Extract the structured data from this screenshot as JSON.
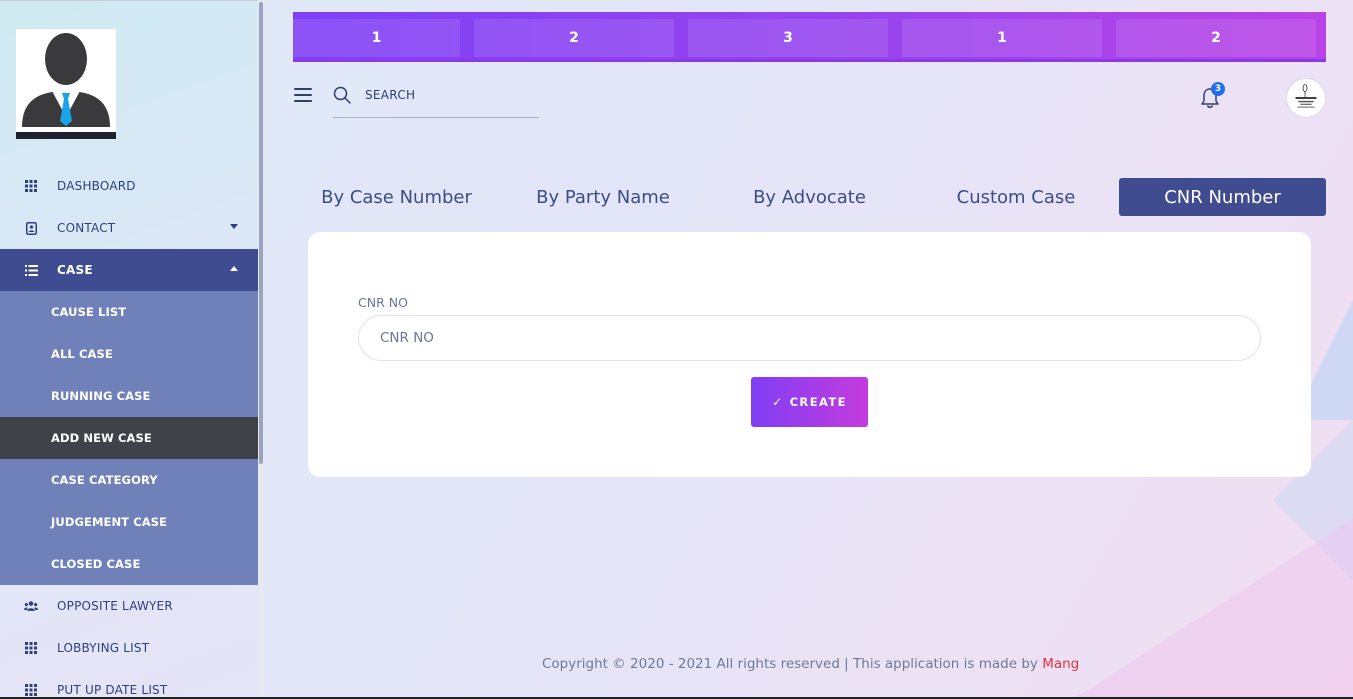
{
  "sidebar": {
    "nav": [
      {
        "label": "DASHBOARD",
        "icon": "grid-icon"
      },
      {
        "label": "CONTACT",
        "icon": "contact-card-icon",
        "caret": "down"
      },
      {
        "label": "CASE",
        "icon": "list-icon",
        "caret": "up",
        "active": true
      }
    ],
    "case_submenu": [
      {
        "label": "CAUSE LIST"
      },
      {
        "label": "ALL CASE"
      },
      {
        "label": "RUNNING CASE"
      },
      {
        "label": "ADD NEW CASE",
        "current": true
      },
      {
        "label": "CASE CATEGORY"
      },
      {
        "label": "JUDGEMENT CASE"
      },
      {
        "label": "CLOSED CASE"
      }
    ],
    "nav_after": [
      {
        "label": "OPPOSITE LAWYER",
        "icon": "users-icon"
      },
      {
        "label": "LOBBYING LIST",
        "icon": "grid-icon"
      },
      {
        "label": "PUT UP DATE LIST",
        "icon": "grid-icon"
      }
    ]
  },
  "stats": [
    "1",
    "2",
    "3",
    "1",
    "2"
  ],
  "topbar": {
    "search_placeholder": "SEARCH",
    "notification_count": "3"
  },
  "tabs": [
    {
      "label": "By Case Number"
    },
    {
      "label": "By Party Name"
    },
    {
      "label": "By Advocate"
    },
    {
      "label": "Custom Case"
    },
    {
      "label": "CNR Number",
      "active": true
    }
  ],
  "form": {
    "field_label": "CNR NO",
    "field_placeholder": "CNR NO",
    "field_value": "",
    "create_label": "CREATE"
  },
  "footer": {
    "text": "Copyright © 2020 - 2021 All rights reserved | This application is made by ",
    "brand": "Mang"
  },
  "colors": {
    "sidebar_active": "#3f4c8f",
    "submenu_bg": "#7081ba",
    "submenu_current": "#3f4249",
    "gradient_start": "#7f3ff5",
    "gradient_end": "#c43bdd",
    "footer_brand": "#e53238"
  }
}
